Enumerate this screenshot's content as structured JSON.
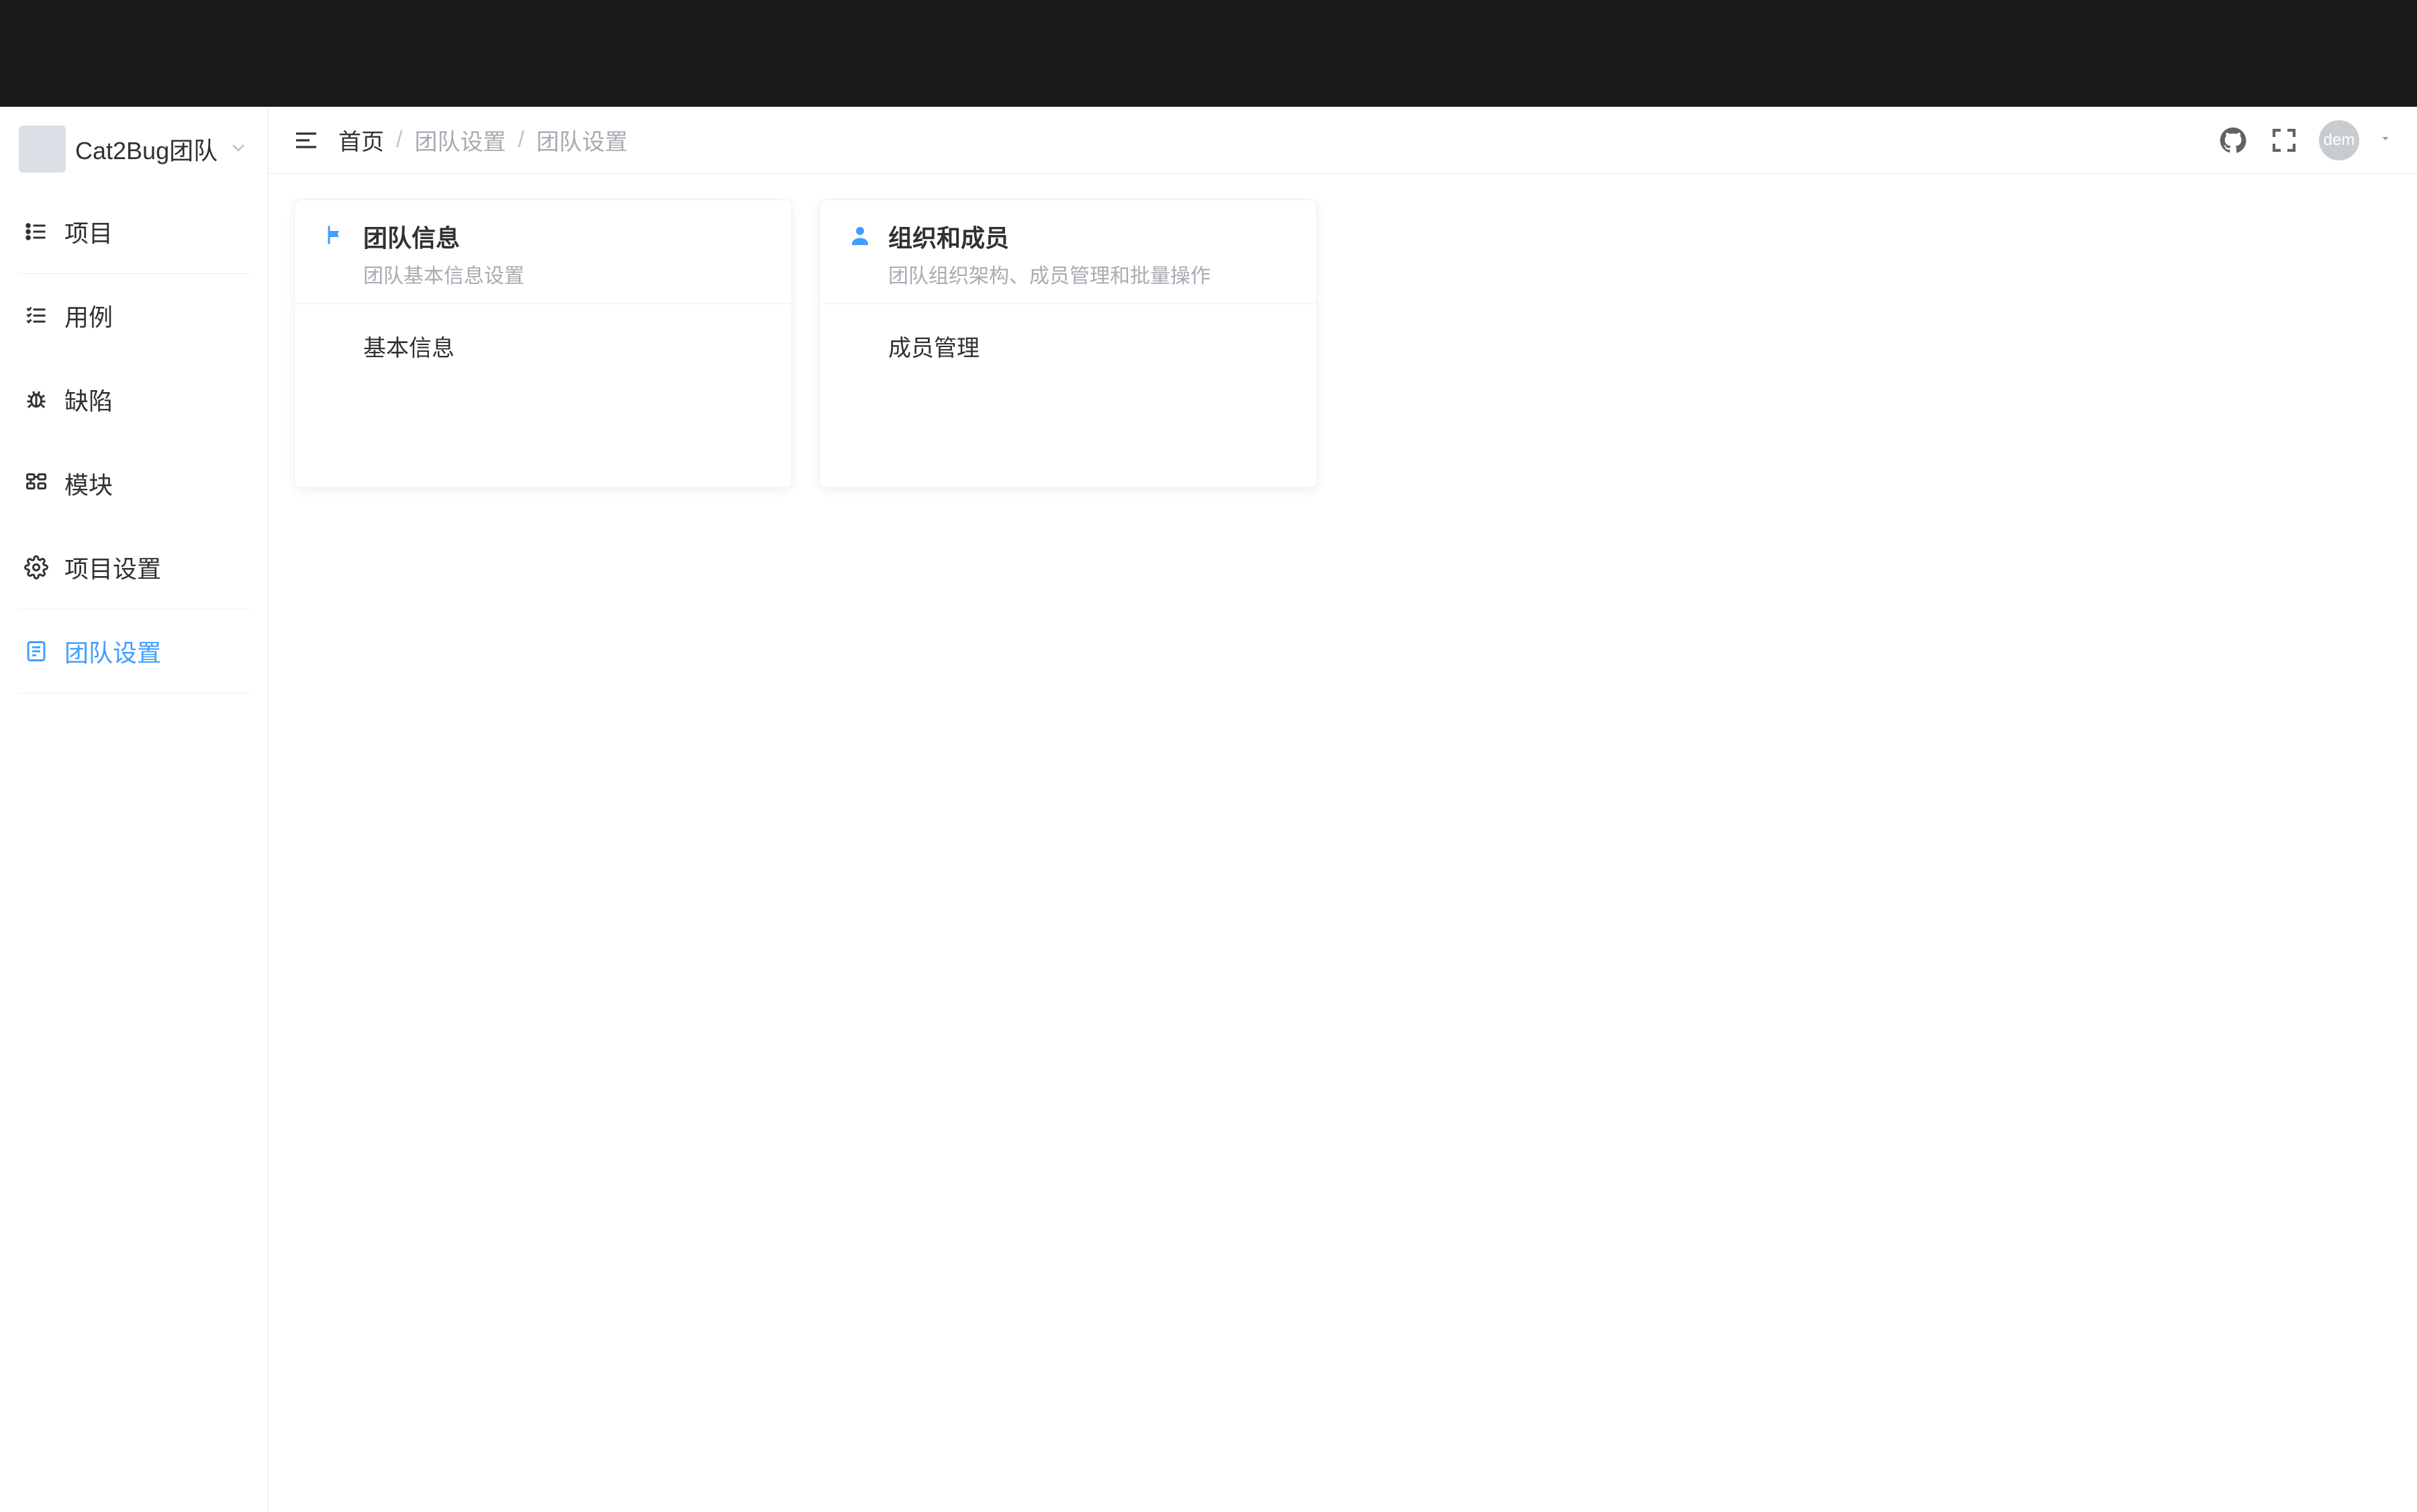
{
  "sidebar": {
    "team_name": "Cat2Bug团队",
    "items": [
      {
        "label": "项目",
        "icon": "list",
        "active": false,
        "divider": true
      },
      {
        "label": "用例",
        "icon": "checklist",
        "active": false,
        "divider": false
      },
      {
        "label": "缺陷",
        "icon": "bug",
        "active": false,
        "divider": false
      },
      {
        "label": "模块",
        "icon": "module",
        "active": false,
        "divider": false
      },
      {
        "label": "项目设置",
        "icon": "gear",
        "active": false,
        "divider": true
      },
      {
        "label": "团队设置",
        "icon": "team-settings",
        "active": true,
        "divider": true
      }
    ]
  },
  "header": {
    "breadcrumb": [
      "首页",
      "团队设置",
      "团队设置"
    ],
    "user_label": "dem"
  },
  "cards": [
    {
      "icon": "flag",
      "title": "团队信息",
      "subtitle": "团队基本信息设置",
      "links": [
        "基本信息"
      ]
    },
    {
      "icon": "person",
      "title": "组织和成员",
      "subtitle": "团队组织架构、成员管理和批量操作",
      "links": [
        "成员管理"
      ]
    }
  ],
  "colors": {
    "primary": "#409eff",
    "text": "#303133",
    "muted": "#a8abb2",
    "border": "#e4e7ed"
  }
}
